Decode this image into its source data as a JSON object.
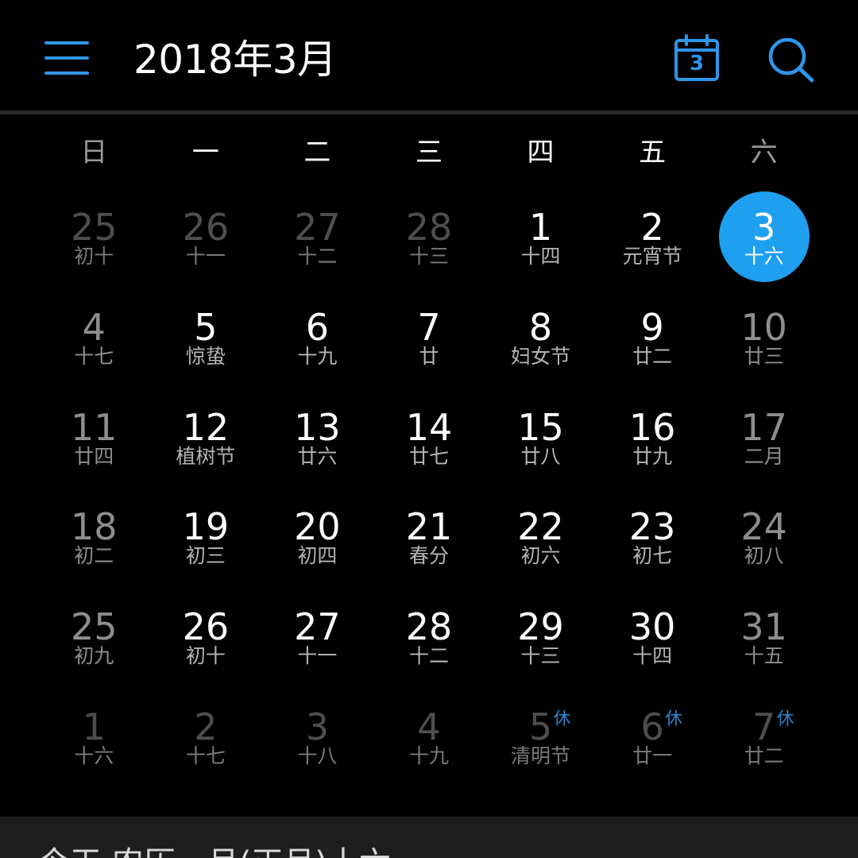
{
  "header": {
    "title": "2018年3月",
    "today_icon_number": "3",
    "accent_color": "#2f95ea",
    "icons": [
      "menu-icon",
      "calendar-today-icon",
      "search-icon"
    ]
  },
  "weekdays": [
    "日",
    "一",
    "二",
    "三",
    "四",
    "五",
    "六"
  ],
  "today_highlight_color": "#1e9ff0",
  "weeks": [
    [
      {
        "day": "25",
        "lunar": "初十",
        "other_month": true
      },
      {
        "day": "26",
        "lunar": "十一",
        "other_month": true
      },
      {
        "day": "27",
        "lunar": "十二",
        "other_month": true
      },
      {
        "day": "28",
        "lunar": "十三",
        "other_month": true
      },
      {
        "day": "1",
        "lunar": "十四"
      },
      {
        "day": "2",
        "lunar": "元宵节"
      },
      {
        "day": "3",
        "lunar": "十六",
        "today": true
      }
    ],
    [
      {
        "day": "4",
        "lunar": "十七"
      },
      {
        "day": "5",
        "lunar": "惊蛰"
      },
      {
        "day": "6",
        "lunar": "十九"
      },
      {
        "day": "7",
        "lunar": "廿"
      },
      {
        "day": "8",
        "lunar": "妇女节"
      },
      {
        "day": "9",
        "lunar": "廿二"
      },
      {
        "day": "10",
        "lunar": "廿三"
      }
    ],
    [
      {
        "day": "11",
        "lunar": "廿四"
      },
      {
        "day": "12",
        "lunar": "植树节"
      },
      {
        "day": "13",
        "lunar": "廿六"
      },
      {
        "day": "14",
        "lunar": "廿七"
      },
      {
        "day": "15",
        "lunar": "廿八"
      },
      {
        "day": "16",
        "lunar": "廿九"
      },
      {
        "day": "17",
        "lunar": "二月"
      }
    ],
    [
      {
        "day": "18",
        "lunar": "初二"
      },
      {
        "day": "19",
        "lunar": "初三"
      },
      {
        "day": "20",
        "lunar": "初四"
      },
      {
        "day": "21",
        "lunar": "春分"
      },
      {
        "day": "22",
        "lunar": "初六"
      },
      {
        "day": "23",
        "lunar": "初七"
      },
      {
        "day": "24",
        "lunar": "初八"
      }
    ],
    [
      {
        "day": "25",
        "lunar": "初九"
      },
      {
        "day": "26",
        "lunar": "初十"
      },
      {
        "day": "27",
        "lunar": "十一"
      },
      {
        "day": "28",
        "lunar": "十二"
      },
      {
        "day": "29",
        "lunar": "十三"
      },
      {
        "day": "30",
        "lunar": "十四"
      },
      {
        "day": "31",
        "lunar": "十五"
      }
    ],
    [
      {
        "day": "1",
        "lunar": "十六",
        "other_month": true
      },
      {
        "day": "2",
        "lunar": "十七",
        "other_month": true
      },
      {
        "day": "3",
        "lunar": "十八",
        "other_month": true
      },
      {
        "day": "4",
        "lunar": "十九",
        "other_month": true
      },
      {
        "day": "5",
        "lunar": "清明节",
        "other_month": true,
        "holiday": "休"
      },
      {
        "day": "6",
        "lunar": "廿一",
        "other_month": true,
        "holiday": "休"
      },
      {
        "day": "7",
        "lunar": "廿二",
        "other_month": true,
        "holiday": "休"
      }
    ]
  ],
  "info_bar": {
    "text": "今天 农历一月(正月)十六"
  }
}
